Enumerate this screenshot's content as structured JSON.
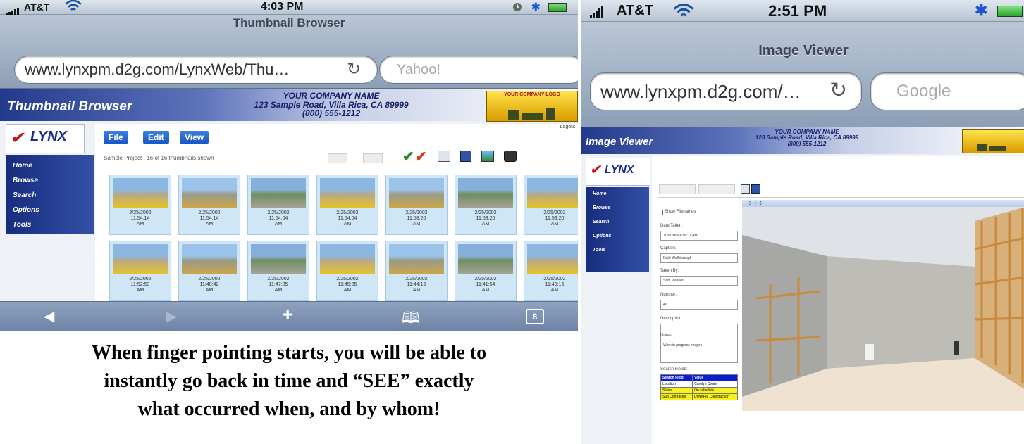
{
  "left": {
    "status": {
      "carrier": "AT&T",
      "time": "4:03 PM"
    },
    "page_title": "Thumbnail Browser",
    "url": "www.lynxpm.d2g.com/LynxWeb/Thu…",
    "search_placeholder": "Yahoo!",
    "site": {
      "name": "Thumbnail Browser",
      "company": [
        "YOUR COMPANY NAME",
        "123 Sample Road, Villa Rica, CA 89999",
        "(800) 555-1212"
      ],
      "logo_text": "YOUR COMPANY LOGO",
      "logout": "Logout"
    },
    "nav": [
      "Home",
      "Browse",
      "Search",
      "Options",
      "Tools"
    ],
    "menus": [
      "File",
      "Edit",
      "View"
    ],
    "project_info": "Sample Project - 16 of 16 thumbnails shown",
    "thumbs_row1": [
      {
        "date": "2/25/2002",
        "time": "11:54:14",
        "ampm": "AM"
      },
      {
        "date": "2/25/2002",
        "time": "11:54:14",
        "ampm": "AM"
      },
      {
        "date": "2/25/2002",
        "time": "11:54:04",
        "ampm": "AM"
      },
      {
        "date": "2/25/2002",
        "time": "11:54:04",
        "ampm": "AM"
      },
      {
        "date": "2/25/2002",
        "time": "11:53:20",
        "ampm": "AM"
      },
      {
        "date": "2/25/2002",
        "time": "11:53:20",
        "ampm": "AM"
      },
      {
        "date": "2/25/2002",
        "time": "11:53:20",
        "ampm": "AM"
      }
    ],
    "thumbs_row2": [
      {
        "date": "2/25/2002",
        "time": "11:52:53",
        "ampm": "AM"
      },
      {
        "date": "2/25/2002",
        "time": "11:48:42",
        "ampm": "AM"
      },
      {
        "date": "2/25/2002",
        "time": "11:47:05",
        "ampm": "AM"
      },
      {
        "date": "2/25/2002",
        "time": "11:45:05",
        "ampm": "AM"
      },
      {
        "date": "2/25/2002",
        "time": "11:44:16",
        "ampm": "AM"
      },
      {
        "date": "2/25/2002",
        "time": "11:41:54",
        "ampm": "AM"
      },
      {
        "date": "2/25/2002",
        "time": "11:40:16",
        "ampm": "AM"
      }
    ],
    "tab_count": "8"
  },
  "caption": [
    "When finger pointing starts, you will be able to",
    "instantly go back in time and “SEE” exactly",
    "what occurred when, and by whom!"
  ],
  "right": {
    "status": {
      "carrier": "AT&T",
      "time": "2:51 PM"
    },
    "page_title": "Image Viewer",
    "url": "www.lynxpm.d2g.com/…",
    "search_placeholder": "Google",
    "site": {
      "name": "Image Viewer",
      "company": [
        "YOUR COMPANY NAME",
        "123 Sample Road, Villa Rica, CA 89999",
        "(800) 555-1212"
      ]
    },
    "nav": [
      "Home",
      "Browse",
      "Search",
      "Options",
      "Tools"
    ],
    "form": {
      "show_filenames": "Show Filenames",
      "date_taken_label": "Date Taken:",
      "date_taken_value": "7/26/2009 4:09:11 AM",
      "caption_label": "Caption:",
      "caption_value": "Daily Walkthrough",
      "taken_by_label": "Taken By:",
      "taken_by_value": "Sam Pleaser",
      "number_label": "Number:",
      "number_value": "40",
      "description_label": "Description:",
      "notes_label": "Notes:",
      "notes_value": "Work in progress images",
      "search_fields_label": "Search Fields:",
      "table_headers": [
        "Search Field",
        "Value"
      ],
      "table_rows": [
        [
          "Location",
          "Carolyn Center"
        ],
        [
          "Status",
          "On schedule"
        ],
        [
          "Sub Contractor",
          "LYNXPM Construction"
        ]
      ]
    }
  }
}
